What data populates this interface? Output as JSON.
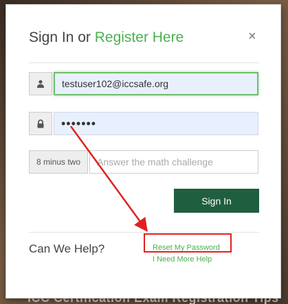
{
  "background": {
    "caption": "ICC Certification Exam Registration Tips"
  },
  "dialog": {
    "title_prefix": "Sign In or ",
    "title_link": "Register Here",
    "close_glyph": "×"
  },
  "form": {
    "email_value": "testuser102@iccsafe.org",
    "password_value": "•••••••",
    "math_challenge_label": "8 minus two",
    "math_placeholder": "Answer the math challenge",
    "signin_label": "Sign In"
  },
  "help": {
    "label": "Can We Help?",
    "reset_password": "Reset My Password",
    "need_more_help": "I Need More Help"
  },
  "icons": {
    "user": "user-icon",
    "lock": "lock-icon",
    "close": "close-icon"
  },
  "colors": {
    "accent_green": "#4caf50",
    "button_green": "#1f5e3f",
    "annotation_red": "#e02020",
    "field_fill": "#e8f0fe"
  }
}
